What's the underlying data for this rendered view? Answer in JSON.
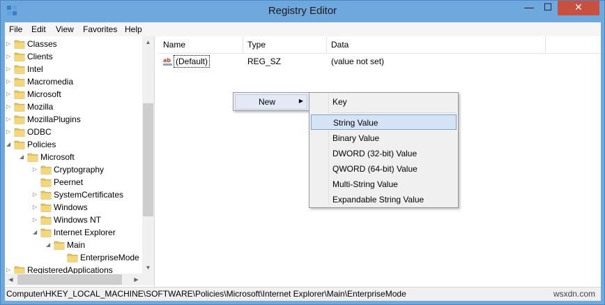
{
  "window": {
    "title": "Registry Editor",
    "minimize_glyph": "—",
    "maximize_glyph": "☐",
    "close_glyph": "✕"
  },
  "menubar": {
    "items": [
      "File",
      "Edit",
      "View",
      "Favorites",
      "Help"
    ]
  },
  "tree": {
    "nodes": [
      {
        "label": "Classes",
        "level": 0,
        "expander": "collapsed"
      },
      {
        "label": "Clients",
        "level": 0,
        "expander": "collapsed"
      },
      {
        "label": "Intel",
        "level": 0,
        "expander": "collapsed"
      },
      {
        "label": "Macromedia",
        "level": 0,
        "expander": "collapsed"
      },
      {
        "label": "Microsoft",
        "level": 0,
        "expander": "collapsed"
      },
      {
        "label": "Mozilla",
        "level": 0,
        "expander": "collapsed"
      },
      {
        "label": "MozillaPlugins",
        "level": 0,
        "expander": "collapsed"
      },
      {
        "label": "ODBC",
        "level": 0,
        "expander": "collapsed"
      },
      {
        "label": "Policies",
        "level": 0,
        "expander": "expanded"
      },
      {
        "label": "Microsoft",
        "level": 1,
        "expander": "expanded"
      },
      {
        "label": "Cryptography",
        "level": 2,
        "expander": "collapsed"
      },
      {
        "label": "Peernet",
        "level": 2,
        "expander": "none"
      },
      {
        "label": "SystemCertificates",
        "level": 2,
        "expander": "collapsed"
      },
      {
        "label": "Windows",
        "level": 2,
        "expander": "collapsed"
      },
      {
        "label": "Windows NT",
        "level": 2,
        "expander": "collapsed"
      },
      {
        "label": "Internet Explorer",
        "level": 2,
        "expander": "expanded"
      },
      {
        "label": "Main",
        "level": 3,
        "expander": "expanded"
      },
      {
        "label": "EnterpriseMode",
        "level": 4,
        "expander": "none"
      },
      {
        "label": "RegisteredApplications",
        "level": 0,
        "expander": "collapsed"
      }
    ]
  },
  "list": {
    "columns": [
      "Name",
      "Type",
      "Data"
    ],
    "rows": [
      {
        "name": "(Default)",
        "type": "REG_SZ",
        "data": "(value not set)",
        "icon": "string-value-icon"
      }
    ]
  },
  "context_menu": {
    "new_label": "New",
    "submenu": {
      "key_label": "Key",
      "items": [
        "String Value",
        "Binary Value",
        "DWORD (32-bit) Value",
        "QWORD (64-bit) Value",
        "Multi-String Value",
        "Expandable String Value"
      ],
      "highlighted_index": 0
    }
  },
  "statusbar": {
    "path": "Computer\\HKEY_LOCAL_MACHINE\\SOFTWARE\\Policies\\Microsoft\\Internet Explorer\\Main\\EnterpriseMode",
    "watermark": "wsxdn.com"
  },
  "colors": {
    "titlebar": "#6ea8dc",
    "close_button": "#c7503f",
    "folder": "#e8c25a",
    "highlight": "#d5e4f5"
  }
}
